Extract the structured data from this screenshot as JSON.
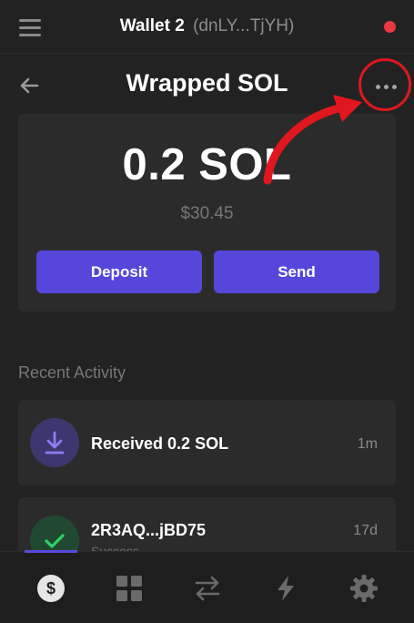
{
  "header": {
    "wallet_name": "Wallet 2",
    "wallet_address": "(dnLY...TjYH)",
    "status_color": "#eb3742"
  },
  "token": {
    "title": "Wrapped SOL"
  },
  "balance": {
    "amount": "0.2 SOL",
    "usd": "$30.45"
  },
  "actions": {
    "deposit_label": "Deposit",
    "send_label": "Send"
  },
  "activity": {
    "section_label": "Recent Activity",
    "items": [
      {
        "icon": "download-icon",
        "title": "Received 0.2 SOL",
        "time": "1m"
      },
      {
        "icon": "check-icon",
        "title": "2R3AQ...jBD75",
        "subtitle": "Success",
        "time": "17d"
      }
    ]
  },
  "nav": {
    "items": [
      "dollar-icon",
      "grid-icon",
      "swap-icon",
      "bolt-icon",
      "gear-icon"
    ],
    "active_index": 0
  },
  "colors": {
    "background": "#222222",
    "card": "#2b2b2b",
    "accent": "#5746da",
    "highlight": "#e0171e"
  }
}
